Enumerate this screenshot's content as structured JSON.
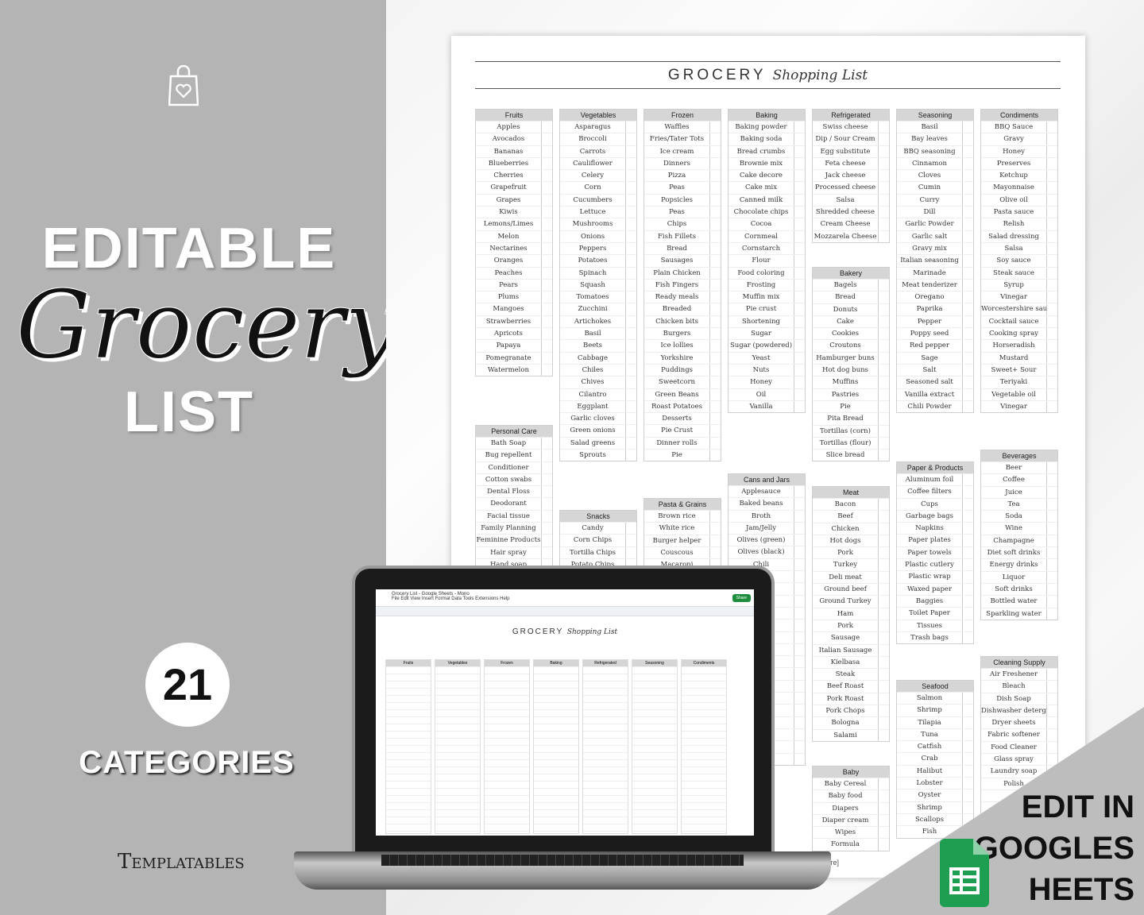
{
  "left": {
    "line1": "EDITABLE",
    "line2": "Grocery",
    "line3": "LIST",
    "count": "21",
    "count_label": "CATEGORIES",
    "brand": "Templatables"
  },
  "doc": {
    "title_caps": "GROCERY",
    "title_script": "Shopping List",
    "footer": "[name here]"
  },
  "spreadsheet": {
    "window_title": "Grocery List - Google Sheets - Mono",
    "menu": "File  Edit  View  Insert  Format  Data  Tools  Extensions  Help",
    "share": "Share"
  },
  "corner": {
    "line1": "EDIT IN",
    "line2": "GOOGLES",
    "line3": "HEETS",
    "accent": "#1e8e3e"
  },
  "categories": [
    {
      "name": "Fruits",
      "items": [
        "Apples",
        "Avocados",
        "Bananas",
        "Blueberries",
        "Cherries",
        "Grapefruit",
        "Grapes",
        "Kiwis",
        "Lemons/Limes",
        "Melon",
        "Nectarines",
        "Oranges",
        "Peaches",
        "Pears",
        "Plums",
        "Mangoes",
        "Strawberries",
        "Apricots",
        "Papaya",
        "Pomegranate",
        "Watermelon"
      ]
    },
    {
      "name": "Vegetables",
      "items": [
        "Asparagus",
        "Broccoli",
        "Carrots",
        "Cauliflower",
        "Celery",
        "Corn",
        "Cucumbers",
        "Lettuce",
        "Mushrooms",
        "Onions",
        "Peppers",
        "Potatoes",
        "Spinach",
        "Squash",
        "Tomatoes",
        "Zucchini",
        "Artichokes",
        "Basil",
        "Beets",
        "Cabbage",
        "Chiles",
        "Chives",
        "Cilantro",
        "Eggplant",
        "Garlic cloves",
        "Green onions",
        "Salad greens",
        "Sprouts"
      ]
    },
    {
      "name": "Frozen",
      "items": [
        "Waffles",
        "Fries/Tater Tots",
        "Ice cream",
        "Dinners",
        "Pizza",
        "Peas",
        "Popsicles",
        "Peas",
        "Chips",
        "Fish Fillets",
        "Bread",
        "Sausages",
        "Plain Chicken",
        "Fish Fingers",
        "Ready meals",
        "Breaded",
        "Chicken bits",
        "Burgers",
        "Ice lollies",
        "Yorkshire",
        "Puddings",
        "Sweetcorn",
        "Green Beans",
        "Roast Potatoes",
        "Desserts",
        "Pie Crust",
        "Dinner rolls",
        "Pie"
      ]
    },
    {
      "name": "Baking",
      "items": [
        "Baking powder",
        "Baking soda",
        "Bread crumbs",
        "Brownie mix",
        "Cake decore",
        "Cake mix",
        "Canned milk",
        "Chocolate chips",
        "Cocoa",
        "Cornmeal",
        "Cornstarch",
        "Flour",
        "Food coloring",
        "Frosting",
        "Muffin mix",
        "Pie crust",
        "Shortening",
        "Sugar",
        "Sugar (powdered)",
        "Yeast",
        "Nuts",
        "Honey",
        "Oil",
        "Vanilla"
      ]
    },
    {
      "name": "Refrigerated",
      "items": [
        "Swiss cheese",
        "Dip / Sour Cream",
        "Egg substitute",
        "Feta cheese",
        "Jack cheese",
        "Processed cheese",
        "Salsa",
        "Shredded cheese",
        "Cream Cheese",
        "Mozzarela Cheese"
      ]
    },
    {
      "name": "Seasoning",
      "items": [
        "Basil",
        "Bay leaves",
        "BBQ seasoning",
        "Cinnamon",
        "Cloves",
        "Cumin",
        "Curry",
        "Dill",
        "Garlic Powder",
        "Garlic salt",
        "Gravy mix",
        "Italian seasoning",
        "Marinade",
        "Meat tenderizer",
        "Oregano",
        "Paprika",
        "Pepper",
        "Poppy seed",
        "Red pepper",
        "Sage",
        "Salt",
        "Seasoned salt",
        "Vanilla extract",
        "Chili Powder"
      ]
    },
    {
      "name": "Condiments",
      "items": [
        "BBQ Sauce",
        "Gravy",
        "Honey",
        "Preserves",
        "Ketchup",
        "Mayonnaise",
        "Olive oil",
        "Pasta sauce",
        "Relish",
        "Salad dressing",
        "Salsa",
        "Soy sauce",
        "Steak sauce",
        "Syrup",
        "Vinegar",
        "Worcestershire sauce",
        "Cocktail sauce",
        "Cooking spray",
        "Horseradish",
        "Mustard",
        "Sweet+ Sour",
        "Teriyaki",
        "Vegetable oil",
        "Vinegar"
      ]
    },
    {
      "name": "Bakery",
      "items": [
        "Bagels",
        "Bread",
        "Donuts",
        "Cake",
        "Cookies",
        "Croutons",
        "Hamburger buns",
        "Hot dog buns",
        "Muffins",
        "Pastries",
        "Pie",
        "Pita Bread",
        "Tortillas (corn)",
        "Tortillas (flour)",
        "Slice bread"
      ]
    },
    {
      "name": "Personal Care",
      "items": [
        "Bath Soap",
        "Bug repellent",
        "Conditioner",
        "Cotton swabs",
        "Dental Floss",
        "Deodorant",
        "Facial tissue",
        "Family Planning",
        "Feminine Products",
        "Hair spray",
        "Hand soap"
      ]
    },
    {
      "name": "Snacks",
      "items": [
        "Candy",
        "Corn Chips",
        "Tortilla Chips",
        "Potato Chips"
      ]
    },
    {
      "name": "Pasta & Grains",
      "items": [
        "Brown rice",
        "White rice",
        "Burger helper",
        "Couscous",
        "Macaroni"
      ]
    },
    {
      "name": "Cans and Jars",
      "items": [
        "Applesauce",
        "Baked beans",
        "Broth",
        "Jam/Jelly",
        "Olives (green)",
        "Olives (black)",
        "Chili",
        "",
        "",
        "",
        "",
        "",
        "",
        "",
        "",
        "",
        "",
        "",
        "",
        "",
        "",
        "",
        ""
      ]
    },
    {
      "name": "Meat",
      "items": [
        "Bacon",
        "Beef",
        "Chicken",
        "Hot dogs",
        "Pork",
        "Turkey",
        "Deli meat",
        "Ground beef",
        "Ground Turkey",
        "Ham",
        "Pork",
        "Sausage",
        "Italian Sausage",
        "Kielbasa",
        "Steak",
        "Beef Roast",
        "Pork Roast",
        "Pork Chops",
        "Bologna",
        "Salami"
      ]
    },
    {
      "name": "Baby",
      "items": [
        "Baby Cereal",
        "Baby food",
        "Diapers",
        "Diaper cream",
        "Wipes",
        "Formula"
      ]
    },
    {
      "name": "Paper & Products",
      "items": [
        "Aluminum foil",
        "Coffee filters",
        "Cups",
        "Garbage bags",
        "Napkins",
        "Paper plates",
        "Paper towels",
        "Plastic cutlery",
        "Plastic wrap",
        "Waxed paper",
        "Baggies",
        "Toilet Paper",
        "Tissues",
        "Trash bags"
      ]
    },
    {
      "name": "Seafood",
      "items": [
        "Salmon",
        "Shrimp",
        "Tilapia",
        "Tuna",
        "Catfish",
        "Crab",
        "Halibut",
        "Lobster",
        "Oyster",
        "Shrimp",
        "Scallops",
        "Fish"
      ]
    },
    {
      "name": "Beverages",
      "items": [
        "Beer",
        "Coffee",
        "Juice",
        "Tea",
        "Soda",
        "Wine",
        "Champagne",
        "Diet soft drinks",
        "Energy drinks",
        "Liquor",
        "Soft drinks",
        "Bottled water",
        "Sparkling water"
      ]
    },
    {
      "name": "Cleaning Supply",
      "items": [
        "Air Freshener",
        "Bleach",
        "Dish Soap",
        "Dishwasher detergent",
        "Dryer sheets",
        "Fabric softener",
        "Food Cleaner",
        "Glass spray",
        "Laundry soap",
        "Polish",
        "",
        "",
        ""
      ]
    }
  ]
}
